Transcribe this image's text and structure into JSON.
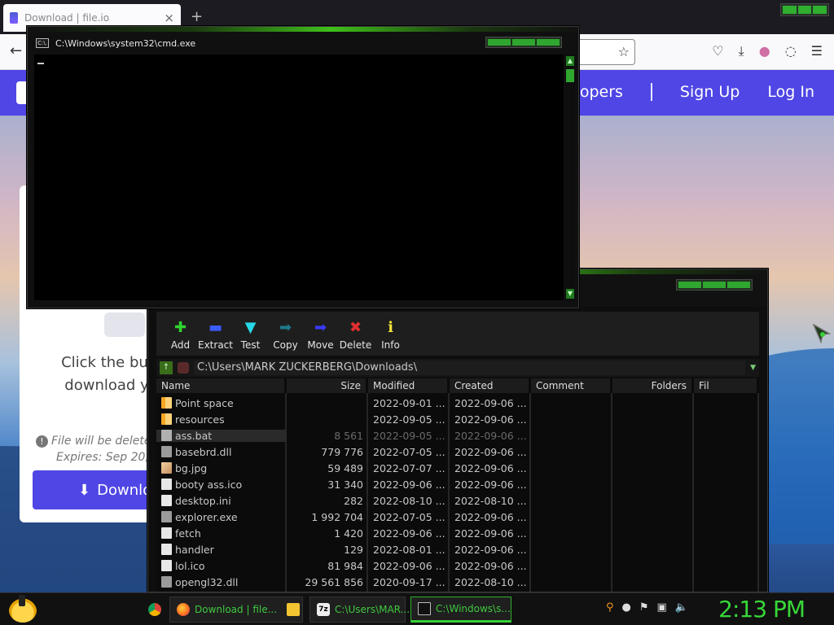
{
  "browser": {
    "tab_title": "Download | file.io",
    "new_tab": "+",
    "tab_close": "×",
    "site_nav": [
      "velopers",
      "Sign Up",
      "Log In"
    ],
    "card": {
      "message_line1": "Click the butto",
      "message_line2": "download y",
      "notice_line1": "File will be delete",
      "notice_line2": "Expires: Sep 20,",
      "download_label": "Downlo"
    }
  },
  "console": {
    "title": "C:\\Windows\\system32\\cmd.exe",
    "icon": "C:\\."
  },
  "sevenzip": {
    "toolbar": [
      {
        "label": "Add",
        "icon": "✚",
        "color": "#2fd42f"
      },
      {
        "label": "Extract",
        "icon": "▬",
        "color": "#3a5cff"
      },
      {
        "label": "Test",
        "icon": "▼",
        "color": "#27d8e8"
      },
      {
        "label": "Copy",
        "icon": "➡",
        "color": "#1e7a8a"
      },
      {
        "label": "Move",
        "icon": "➡",
        "color": "#3a3aff"
      },
      {
        "label": "Delete",
        "icon": "✖",
        "color": "#e03030"
      },
      {
        "label": "Info",
        "icon": "ℹ",
        "color": "#f2e23a"
      }
    ],
    "path": "C:\\Users\\MARK ZUCKERBERG\\Downloads\\",
    "columns": [
      "Name",
      "Size",
      "Modified",
      "Created",
      "Comment",
      "Folders",
      "Fil"
    ],
    "files": [
      {
        "name": "Point space",
        "size": "",
        "modified": "2022-09-01 ...",
        "created": "2022-09-06 ...",
        "type": "folder"
      },
      {
        "name": "resources",
        "size": "",
        "modified": "2022-09-05 ...",
        "created": "2022-09-06 ...",
        "type": "folder"
      },
      {
        "name": "ass.bat",
        "size": "8 561",
        "modified": "2022-09-05 ...",
        "created": "2022-09-06 ...",
        "type": "bat",
        "selected": true
      },
      {
        "name": "basebrd.dll",
        "size": "779 776",
        "modified": "2022-07-05 ...",
        "created": "2022-09-06 ...",
        "type": "exe"
      },
      {
        "name": "bg.jpg",
        "size": "59 489",
        "modified": "2022-07-07 ...",
        "created": "2022-09-06 ...",
        "type": "img"
      },
      {
        "name": "booty ass.ico",
        "size": "31 340",
        "modified": "2022-09-06 ...",
        "created": "2022-09-06 ...",
        "type": "file"
      },
      {
        "name": "desktop.ini",
        "size": "282",
        "modified": "2022-08-10 ...",
        "created": "2022-08-10 ...",
        "type": "file"
      },
      {
        "name": "explorer.exe",
        "size": "1 992 704",
        "modified": "2022-07-05 ...",
        "created": "2022-09-06 ...",
        "type": "exe"
      },
      {
        "name": "fetch",
        "size": "1 420",
        "modified": "2022-09-06 ...",
        "created": "2022-09-06 ...",
        "type": "file"
      },
      {
        "name": "handler",
        "size": "129",
        "modified": "2022-08-01 ...",
        "created": "2022-09-06 ...",
        "type": "file"
      },
      {
        "name": "lol.ico",
        "size": "81 984",
        "modified": "2022-09-06 ...",
        "created": "2022-09-06 ...",
        "type": "file"
      },
      {
        "name": "opengl32.dll",
        "size": "29 561 856",
        "modified": "2020-09-17 ...",
        "created": "2022-08-10 ...",
        "type": "exe"
      }
    ]
  },
  "taskbar": {
    "items": [
      "Download | file...",
      "C:\\Users\\MAR...",
      "C:\\Windows\\s..."
    ],
    "clock": "2:13 PM"
  },
  "colors": {
    "accent_green": "#37d037",
    "site_purple": "#4f46e5"
  }
}
